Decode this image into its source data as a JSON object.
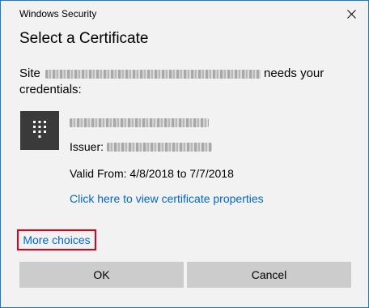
{
  "window": {
    "title": "Windows Security",
    "close_icon": "close-icon"
  },
  "dialog": {
    "heading": "Select a Certificate",
    "site_prefix": "Site",
    "site_suffix": "needs your credentials:",
    "certificate": {
      "icon": "certificate-keypad-icon",
      "issuer_label": "Issuer:",
      "valid_from": "Valid From: 4/8/2018 to 7/7/2018",
      "properties_link": "Click here to view certificate properties"
    },
    "more_choices": "More choices",
    "highlight_color": "#e0001a",
    "link_color": "#0066cc"
  },
  "buttons": {
    "ok": "OK",
    "cancel": "Cancel"
  }
}
